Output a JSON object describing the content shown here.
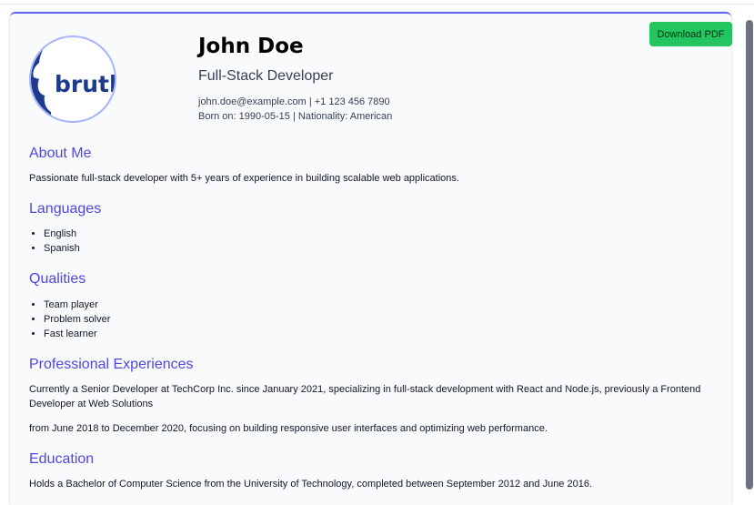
{
  "header": {
    "name": "John Doe",
    "role": "Full-Stack Developer",
    "contact": "john.doe@example.com | +1 123 456 7890",
    "born": "Born on: 1990-05-15 | Nationality: American",
    "logo_text": "brutl"
  },
  "actions": {
    "download_label": "Download PDF"
  },
  "about": {
    "title": "About Me",
    "text": "Passionate full-stack developer with 5+ years of experience in building scalable web applications."
  },
  "languages": {
    "title": "Languages",
    "items": [
      "English",
      "Spanish"
    ]
  },
  "qualities": {
    "title": "Qualities",
    "items": [
      "Team player",
      "Problem solver",
      "Fast learner"
    ]
  },
  "experience": {
    "title": "Professional Experiences",
    "paragraphs": [
      "Currently a Senior Developer at TechCorp Inc. since January 2021, specializing in full-stack development with React and Node.js, previously a Frontend Developer at Web Solutions",
      "from June 2018 to December 2020, focusing on building responsive user interfaces and optimizing web performance."
    ]
  },
  "education": {
    "title": "Education",
    "text": "Holds a Bachelor of Computer Science from the University of Technology, completed between September 2012 and June 2016."
  },
  "colors": {
    "accent": "#4f46e5",
    "button": "#22c55e",
    "avatar_blue": "#1e3a8a"
  }
}
